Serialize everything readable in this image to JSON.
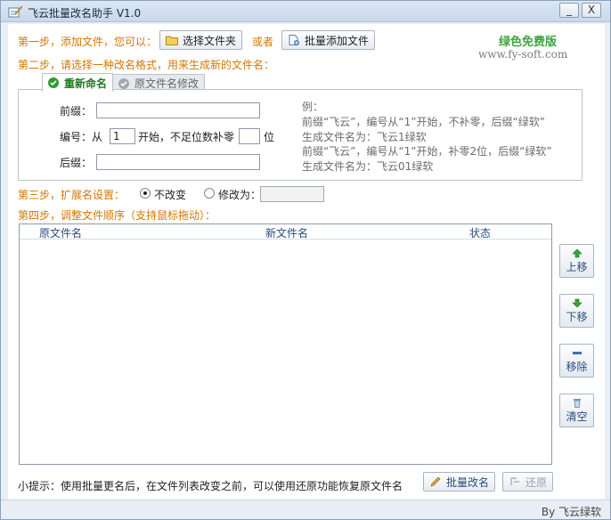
{
  "window": {
    "title": "飞云批量改名助手 V1.0",
    "minimize_glyph": "_",
    "close_glyph": "X"
  },
  "step1": {
    "label": "第一步，添加文件，您可以：",
    "choose_folder_button": "选择文件夹",
    "or_text": "或者",
    "batch_add_button": "批量添加文件"
  },
  "brand": {
    "name": "绿色免费版",
    "site": "www.fy-soft.com"
  },
  "step2": {
    "label": "第二步，请选择一种改名格式，用来生成新的文件名：",
    "tabs": [
      {
        "label": "重新命名",
        "active": true
      },
      {
        "label": "原文件名修改",
        "active": false
      }
    ],
    "prefix_label": "前缀：",
    "prefix_value": "",
    "number_label": "编号：从",
    "number_start": "1",
    "number_mid": "开始，不足位数补零",
    "pad_value": "",
    "pad_unit": "位",
    "suffix_label": "后缀：",
    "suffix_value": "",
    "example": {
      "title": "例：",
      "lines": [
        "前缀“飞云”，编号从“1”开始，不补零，后缀“绿软”",
        "生成文件名为：飞云1绿软",
        "前缀“飞云”，编号从“1”开始，补零2位，后缀“绿软”",
        "生成文件名为：飞云01绿软"
      ]
    }
  },
  "step3": {
    "label": "第三步，扩展名设置：",
    "opt_keep": "不改变",
    "opt_change": "修改为：",
    "selected": "keep",
    "ext_value": ""
  },
  "step4": {
    "label": "第四步，调整文件顺序（支持鼠标拖动）：",
    "columns": [
      "原文件名",
      "新文件名",
      "状态"
    ],
    "rows": []
  },
  "side_buttons": {
    "up": "上移",
    "down": "下移",
    "remove": "移除",
    "clear": "清空"
  },
  "footer": {
    "tip": "小提示：使用批量更名后，在文件列表改变之前，可以使用还原功能恢复原文件名",
    "rename_button": "批量改名",
    "restore_button": "还原"
  },
  "statusbar": {
    "text": "By 飞云绿软"
  },
  "colors": {
    "step_label": "#d47700",
    "brand_green": "#3ea53e",
    "header_blue": "#2a4d7a"
  }
}
